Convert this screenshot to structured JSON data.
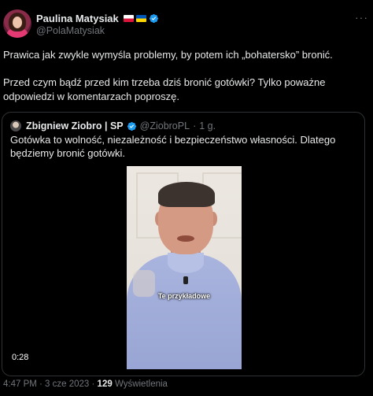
{
  "author": {
    "display_name": "Paulina Matysiak",
    "handle": "@PolaMatysiak",
    "flags": [
      "poland-flag",
      "ukraine-flag"
    ],
    "verified": true,
    "more_label": "···"
  },
  "tweet": {
    "paragraph_1": "Prawica jak zwykle wymyśla problemy, by potem ich „bohatersko” bronić.",
    "paragraph_2": "Przed czym bądź przed kim trzeba dziś bronić gotówki? Tylko poważne odpowiedzi w komentarzach poproszę."
  },
  "quoted": {
    "display_name": "Zbigniew Ziobro | SP",
    "verified": true,
    "handle": "@ZiobroPL",
    "separator": "·",
    "time": "1 g.",
    "text": "Gotówka to wolność, niezależność i bezpieczeństwo własności. Dlatego będziemy bronić gotówki.",
    "video": {
      "caption": "Te przykładowe",
      "timecode": "0:28"
    }
  },
  "footer": {
    "timestamp": "4:47 PM · 3 cze 2023 ·",
    "views_count": "129",
    "views_label": "Wyświetlenia"
  },
  "colors": {
    "background": "#000000",
    "text_primary": "#e7e9ea",
    "text_secondary": "#71767b",
    "verified_blue": "#1d9bf0",
    "border": "#2f3336"
  }
}
